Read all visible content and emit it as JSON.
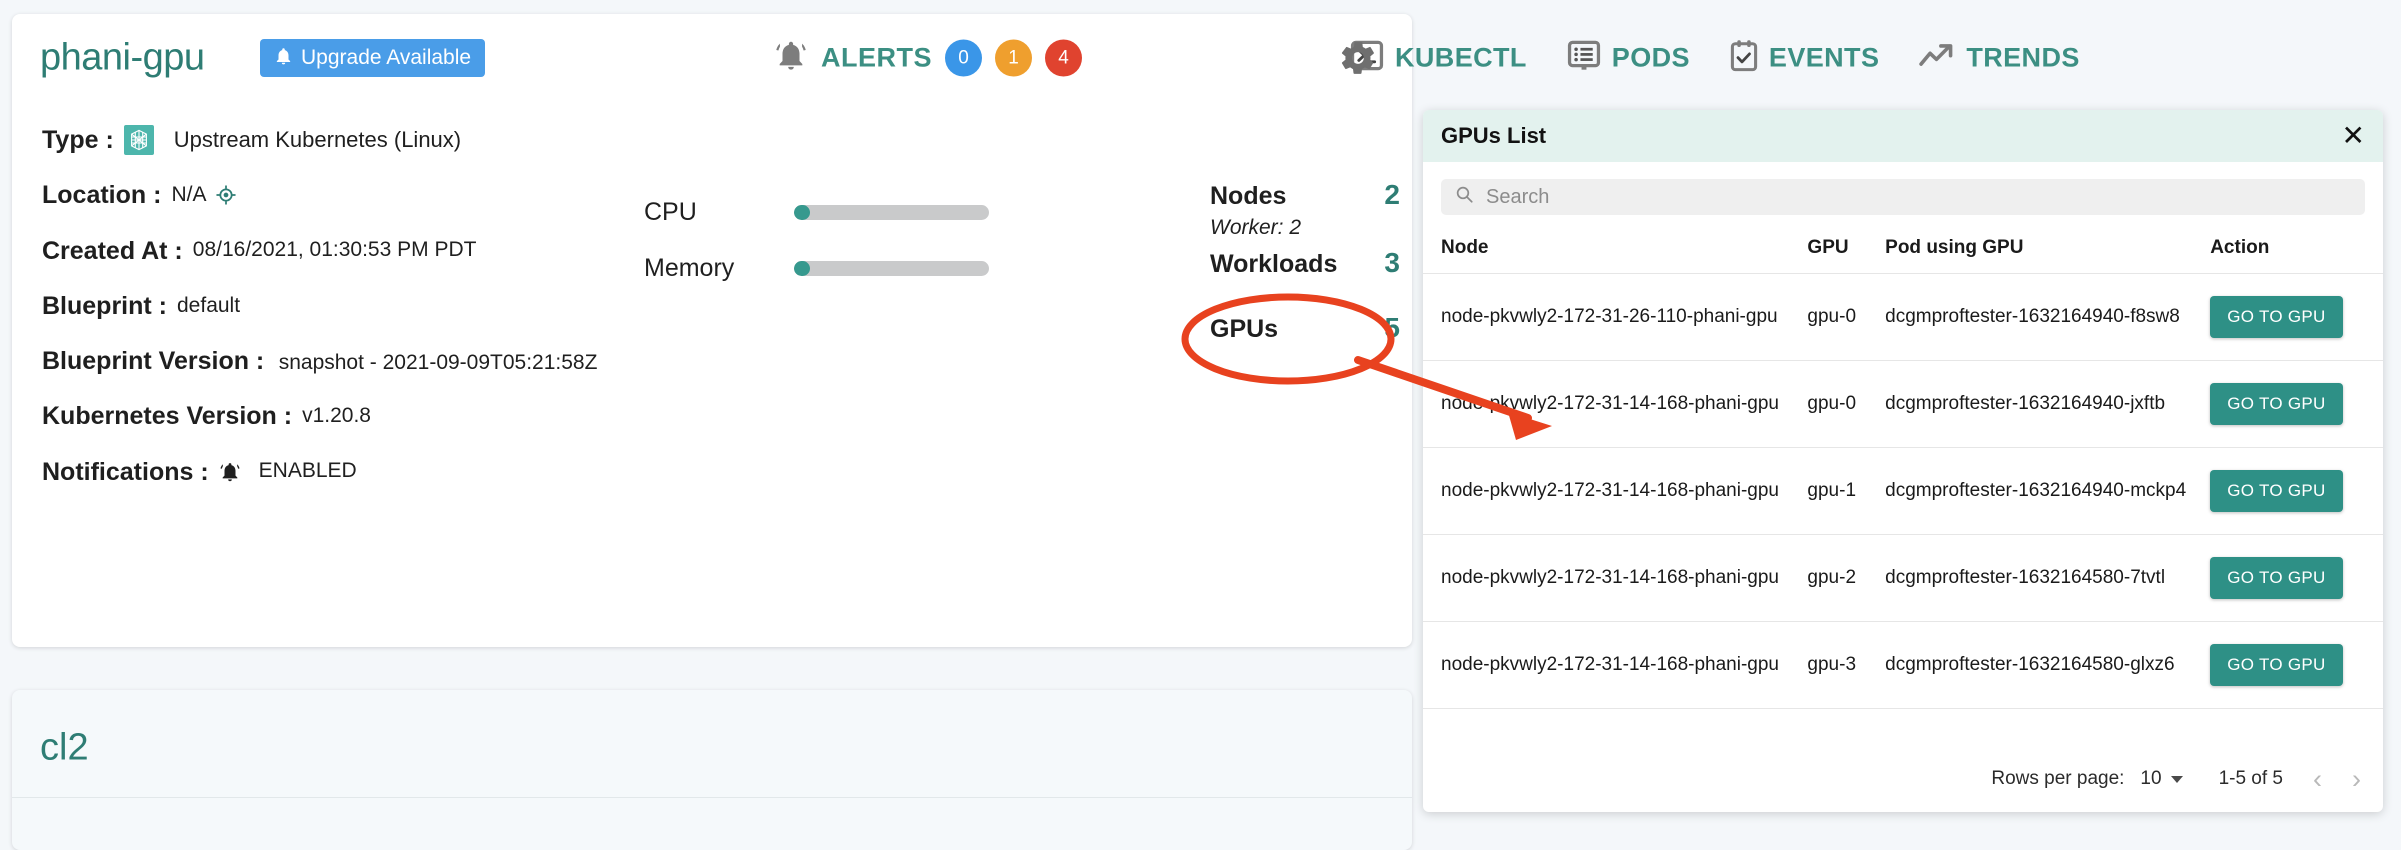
{
  "header": {
    "cluster_name": "phani-gpu",
    "upgrade_label": "Upgrade Available",
    "upgrade_icon": "bell-icon",
    "alerts_label": "ALERTS",
    "alerts_icon": "bell-icon",
    "alert_counts": [
      {
        "value": "0",
        "color": "#3a96e8",
        "severity": "info"
      },
      {
        "value": "1",
        "color": "#ef9f2e",
        "severity": "warning"
      },
      {
        "value": "4",
        "color": "#e0432f",
        "severity": "critical"
      }
    ],
    "nav": [
      {
        "label": "KUBECTL",
        "icon": "terminal-icon"
      },
      {
        "label": "PODS",
        "icon": "list-box-icon"
      },
      {
        "label": "EVENTS",
        "icon": "clipboard-check-icon"
      },
      {
        "label": "TRENDS",
        "icon": "trending-up-icon"
      }
    ],
    "settings_icon": "gear-icon"
  },
  "details": {
    "type_key": "Type :",
    "type_value": "Upstream Kubernetes (Linux)",
    "type_icon": "kubernetes-icon",
    "location_key": "Location :",
    "location_value": "N/A",
    "location_icon": "target-icon",
    "created_key": "Created At :",
    "created_value": "08/16/2021, 01:30:53 PM PDT",
    "blueprint_key": "Blueprint :",
    "blueprint_value": "default",
    "blueprint_version_key": "Blueprint Version :",
    "blueprint_version_value": "snapshot - 2021-09-09T05:21:58Z",
    "k8s_version_key": "Kubernetes Version :",
    "k8s_version_value": "v1.20.8",
    "notifications_key": "Notifications :",
    "notifications_value": "ENABLED",
    "notifications_icon": "bell-icon"
  },
  "gauges": [
    {
      "label": "CPU",
      "percent": 8
    },
    {
      "label": "Memory",
      "percent": 8
    }
  ],
  "stats": {
    "nodes_label": "Nodes",
    "nodes_value": "2",
    "nodes_sub": "Worker: 2",
    "workloads_label": "Workloads",
    "workloads_value": "3",
    "gpus_label": "GPUs",
    "gpus_value": "5"
  },
  "second_card": {
    "title": "cl2"
  },
  "gpus_panel": {
    "title": "GPUs List",
    "close_icon": "close-icon",
    "search_placeholder": "Search",
    "search_value": "",
    "search_icon": "search-icon",
    "columns": [
      "Node",
      "GPU",
      "Pod using GPU",
      "Action"
    ],
    "rows": [
      {
        "node": "node-pkvwly2-172-31-26-110-phani-gpu",
        "gpu": "gpu-0",
        "pod": "dcgmproftester-1632164940-f8sw8",
        "action": "GO TO GPU"
      },
      {
        "node": "node-pkvwly2-172-31-14-168-phani-gpu",
        "gpu": "gpu-0",
        "pod": "dcgmproftester-1632164940-jxftb",
        "action": "GO TO GPU"
      },
      {
        "node": "node-pkvwly2-172-31-14-168-phani-gpu",
        "gpu": "gpu-1",
        "pod": "dcgmproftester-1632164940-mckp4",
        "action": "GO TO GPU"
      },
      {
        "node": "node-pkvwly2-172-31-14-168-phani-gpu",
        "gpu": "gpu-2",
        "pod": "dcgmproftester-1632164580-7tvtl",
        "action": "GO TO GPU"
      },
      {
        "node": "node-pkvwly2-172-31-14-168-phani-gpu",
        "gpu": "gpu-3",
        "pod": "dcgmproftester-1632164580-glxz6",
        "action": "GO TO GPU"
      }
    ],
    "pagination": {
      "rows_per_page_label": "Rows per page:",
      "rows_per_page_value": "10",
      "range_label": "1-5 of 5",
      "prev_icon": "chevron-left-icon",
      "next_icon": "chevron-right-icon"
    }
  },
  "annotation": {
    "color": "#e8421f",
    "shape": "ellipse-and-arrow",
    "target": "GPUs count highlighted, arrow points to second table row"
  },
  "colors": {
    "teal": "#2e7d74",
    "teal_button": "#2e9086",
    "blue": "#4a9de8",
    "panel_header": "#e3f2ee",
    "annotation_red": "#e8421f"
  }
}
